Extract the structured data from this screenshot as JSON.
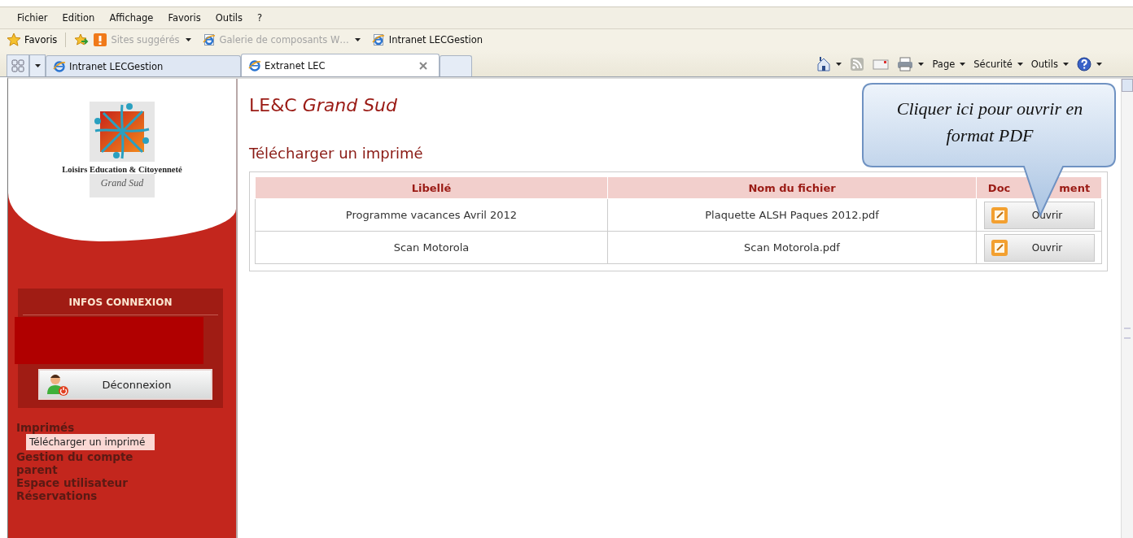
{
  "menu_bar": [
    "Fichier",
    "Edition",
    "Affichage",
    "Favoris",
    "Outils",
    "?"
  ],
  "favorites_bar": {
    "label": "Favoris",
    "links": [
      {
        "kind": "suggested",
        "label": "Sites suggérés",
        "disabled": true,
        "dropdown": true
      },
      {
        "kind": "page",
        "label": "Galerie de composants W…",
        "disabled": true,
        "dropdown": true
      },
      {
        "kind": "page",
        "label": "Intranet LECGestion",
        "disabled": false,
        "dropdown": false
      }
    ]
  },
  "tabs": [
    {
      "title": "Intranet LECGestion",
      "selected": false
    },
    {
      "title": "Extranet LEC",
      "selected": true
    }
  ],
  "command_bar": [
    "Page",
    "Sécurité",
    "Outils"
  ],
  "sidebar": {
    "logo_name": "Loisirs Education & Citoyenneté",
    "logo_region": "Grand Sud",
    "infos_title": "INFOS CONNEXION",
    "logout": "Déconnexion",
    "nav": [
      {
        "label": "Imprimés",
        "selected": false,
        "children": [
          {
            "label": "Télécharger un imprimé",
            "selected": true
          }
        ]
      },
      {
        "label": "Gestion du compte parent",
        "selected": false
      },
      {
        "label": "Espace utilisateur",
        "selected": false
      },
      {
        "label": "Réservations",
        "selected": false
      }
    ]
  },
  "page": {
    "site_title": "LE&C *Grand Sud*",
    "heading": "Télécharger un imprimé",
    "table": {
      "columns": [
        {
          "parts": [
            "Libellé"
          ]
        },
        {
          "parts": [
            "Nom du fichier"
          ]
        },
        {
          "parts": [
            "Doc",
            "ment"
          ]
        }
      ],
      "rows": [
        {
          "label": "Programme vacances Avril 2012",
          "file": "Plaquette ALSH Paques 2012.pdf",
          "action": "Ouvrir"
        },
        {
          "label": "Scan Motorola",
          "file": "Scan Motorola.pdf",
          "action": "Ouvrir"
        }
      ]
    }
  },
  "callout": "Cliquer ici pour ouvrir en format PDF"
}
